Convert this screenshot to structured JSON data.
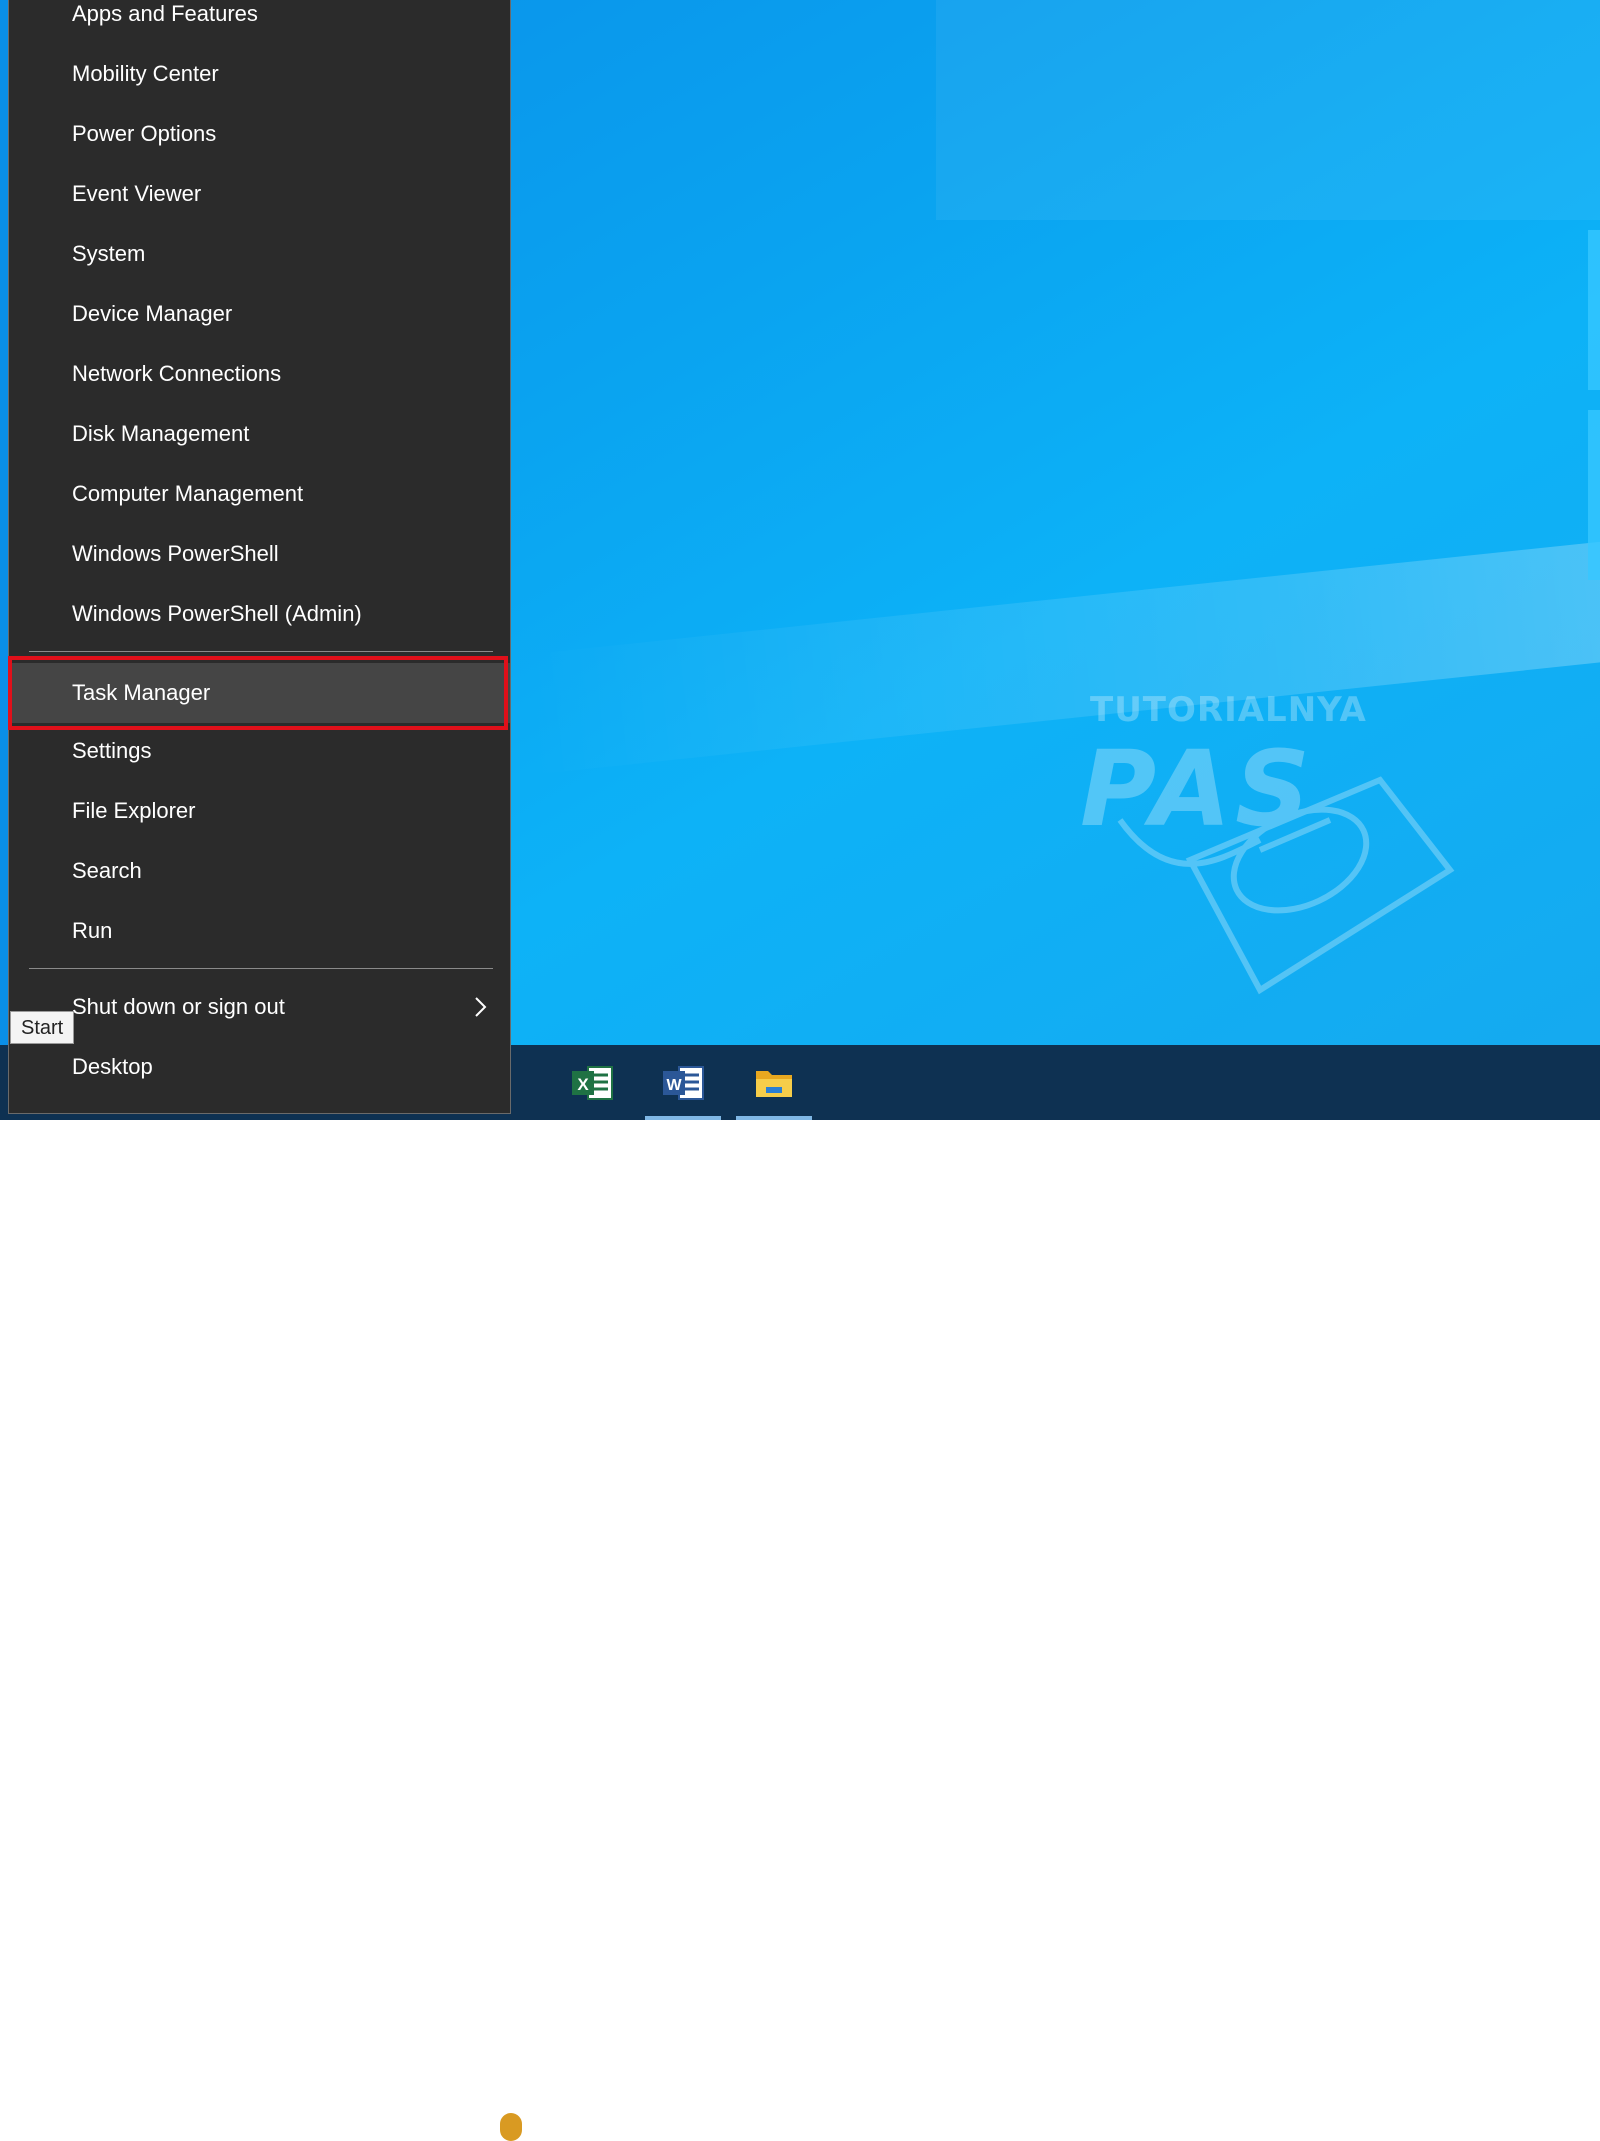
{
  "menu": {
    "items": [
      {
        "label": "Apps and Features"
      },
      {
        "label": "Mobility Center"
      },
      {
        "label": "Power Options"
      },
      {
        "label": "Event Viewer"
      },
      {
        "label": "System"
      },
      {
        "label": "Device Manager"
      },
      {
        "label": "Network Connections"
      },
      {
        "label": "Disk Management"
      },
      {
        "label": "Computer Management"
      },
      {
        "label": "Windows PowerShell"
      },
      {
        "label": "Windows PowerShell (Admin)"
      }
    ],
    "highlighted": {
      "label": "Task Manager"
    },
    "items2": [
      {
        "label": "Settings"
      },
      {
        "label": "File Explorer"
      },
      {
        "label": "Search"
      },
      {
        "label": "Run"
      }
    ],
    "shutdown": {
      "label": "Shut down or sign out"
    },
    "desktop": {
      "label": "Desktop"
    }
  },
  "tooltip": {
    "label": "Start"
  },
  "watermark": {
    "top": "TUTORIALNYA",
    "big": "PAS"
  },
  "taskbar": {
    "apps": [
      {
        "name": "excel-icon",
        "letter": "X",
        "color": "#1f7244"
      },
      {
        "name": "word-icon",
        "letter": "W",
        "color": "#2b5797"
      },
      {
        "name": "file-explorer-icon",
        "letter": "",
        "color": "#f3c33c"
      }
    ]
  },
  "colors": {
    "highlight_border": "#e0101a",
    "menu_bg": "#2b2b2b",
    "taskbar_bg": "#0e3152"
  }
}
